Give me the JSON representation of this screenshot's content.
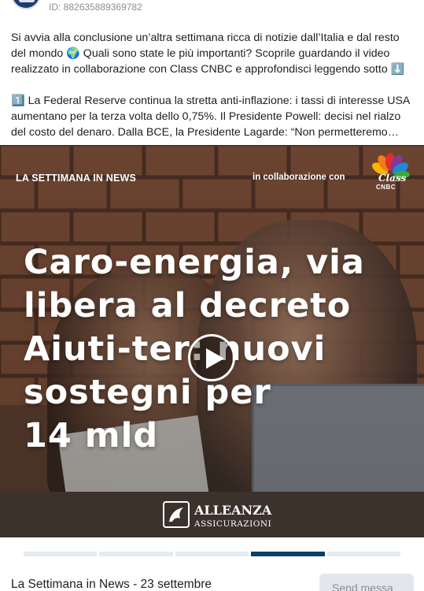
{
  "post": {
    "id_text": "ID: 882635889369782",
    "paragraph1": "Si avvia alla conclusione un’altra settimana ricca di notizie dall’Italia e dal resto del mondo 🌍 Quali sono state le più importanti? Scoprile guardando il video realizzato in collaborazione con Class CNBC e approfondisci leggendo sotto ⬇️",
    "paragraph2": "1️⃣ La Federal Reserve continua la stretta anti-inflazione: i tassi di interesse USA aumentano per la terza volta dello 0,75%. Il Presidente Powell: decisi nel rialzo del costo del denaro. Dalla BCE, la Presidente Lagarde: “Non permetteremo…"
  },
  "video": {
    "label_weekly": "LA SETTIMANA IN NEWS",
    "label_collab": "in collaborazione con",
    "cnbc_class": "Class",
    "cnbc_text": "CNBC",
    "headline": "Caro-energia, via\nlibera al decreto\nAiuti-ter: nuovi\nsostegni per\n14 mld",
    "brand_name": "ALLEANZA",
    "brand_sub": "ASSICURAZIONI",
    "progress": {
      "segments": 5,
      "active_index": 3
    }
  },
  "footer": {
    "title": "La Settimana in News - 23 settembre",
    "send_button": "Send messa"
  },
  "colors": {
    "progress_active": "#0b3e6d",
    "progress_inactive": "#e4eaf1",
    "button_bg": "#e4e6eb"
  },
  "icons": {
    "play": "play-icon",
    "globe": "globe-emoji",
    "arrow_down": "down-arrow-emoji"
  }
}
